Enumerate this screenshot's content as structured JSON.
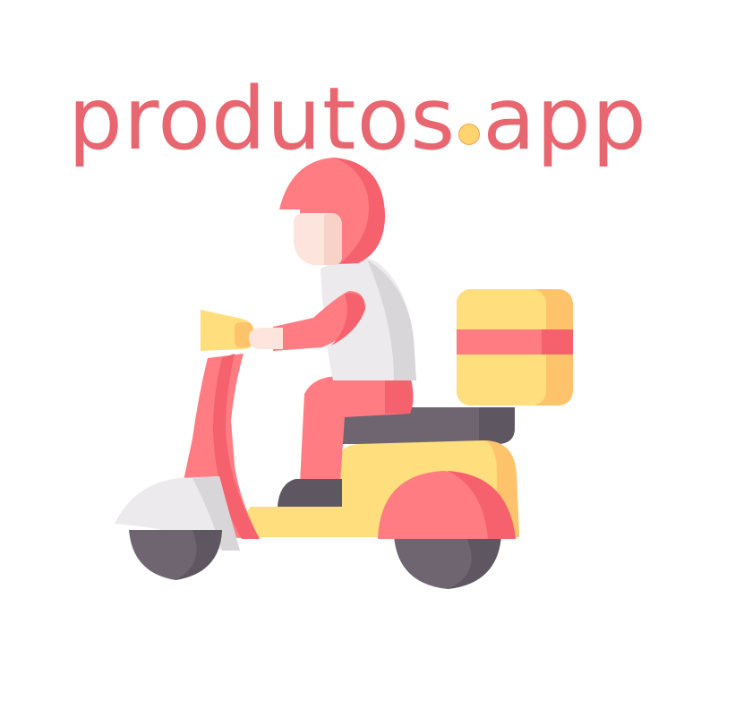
{
  "brand": {
    "name_part1": "produtos",
    "name_part2": "app"
  },
  "colors": {
    "brand_text": "#e8666f",
    "dot_fill": "#ffd36e",
    "helmet": "#ff7c83",
    "helmet_dark": "#f5616c",
    "scooter_body": "#ffde7d",
    "scooter_shadow": "#ffc46b",
    "wheel": "#6e6570",
    "seat": "#5e5660",
    "shirt": "#eceaed",
    "skin": "#fde4dc"
  },
  "illustration": {
    "icon": "delivery-scooter-icon"
  }
}
